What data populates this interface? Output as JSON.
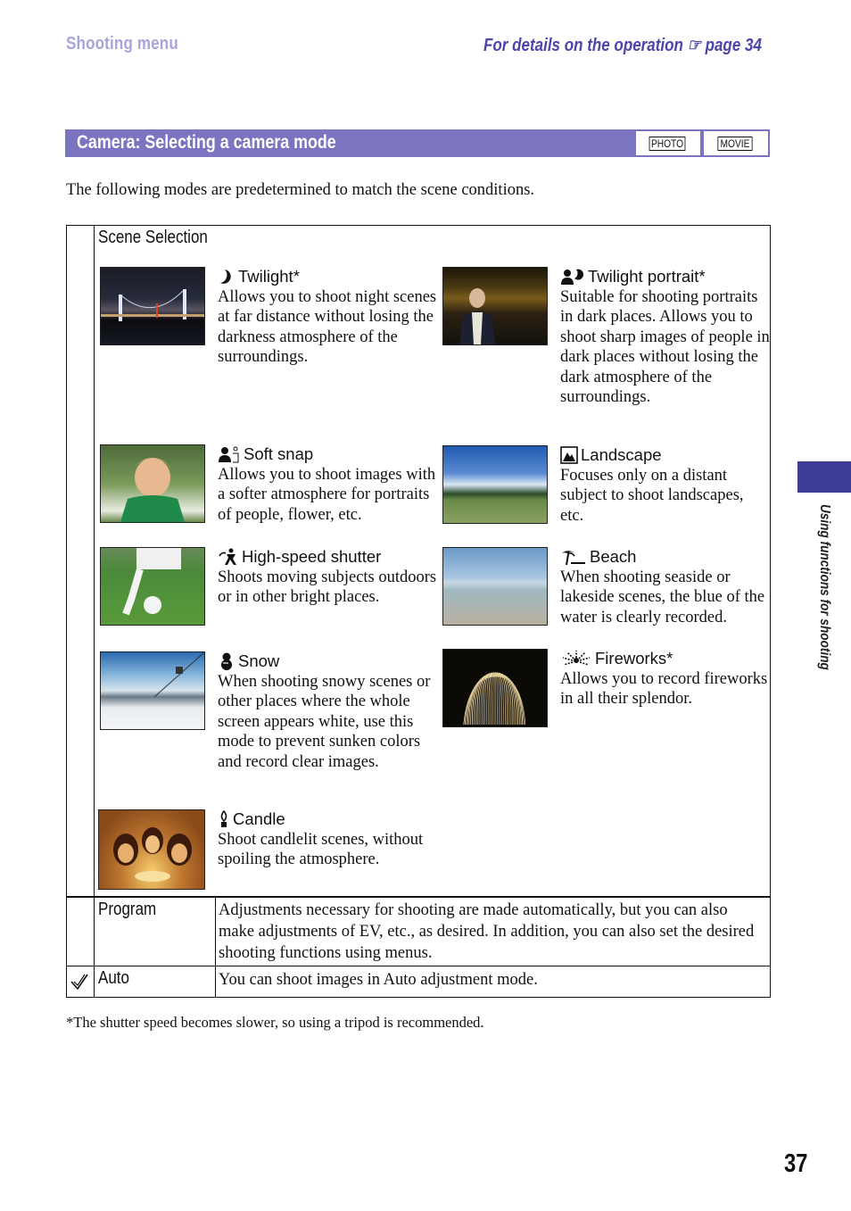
{
  "header": {
    "section": "Shooting menu",
    "operation_ref": "For details on the operation",
    "ref_icon": "pointing-hand-icon",
    "ref_page": "page 34"
  },
  "section": {
    "title": "Camera: Selecting a camera mode",
    "badges": [
      "PHOTO",
      "MOVIE"
    ],
    "color": "#7b74c0"
  },
  "intro": "The following modes are predetermined to match the scene conditions.",
  "table": {
    "scene_selection": {
      "label": "Scene Selection",
      "items": [
        {
          "icon": "moon-icon",
          "title": "Twilight*",
          "desc": "Allows you to shoot night scenes at far distance without losing the darkness atmosphere of the surroundings.",
          "image": "night bridge"
        },
        {
          "icon": "portrait-moon-icon",
          "title": "Twilight portrait*",
          "desc": "Suitable for shooting portraits in dark places. Allows you to shoot sharp images of people in dark places without losing the dark atmosphere of the surroundings.",
          "image": "woman at night"
        },
        {
          "icon": "soft-snap-icon",
          "title": "Soft snap",
          "desc": "Allows you to shoot images with a softer atmosphere for portraits of people, flower, etc.",
          "image": "boy in flowers"
        },
        {
          "icon": "landscape-icon",
          "title": "Landscape",
          "desc": "Focuses only on a distant subject to shoot landscapes, etc.",
          "image": "field and sky"
        },
        {
          "icon": "high-speed-shutter-icon",
          "title": "High-speed shutter",
          "desc": "Shoots moving subjects outdoors or in other bright places.",
          "image": "soccer player"
        },
        {
          "icon": "beach-icon",
          "title": "Beach",
          "desc": "When shooting seaside or lakeside scenes, the blue of the water is clearly recorded.",
          "image": "shallow sea"
        },
        {
          "icon": "snow-icon",
          "title": "Snow",
          "desc": "When shooting snowy scenes or other places where the whole screen appears white, use this mode to prevent sunken colors and record clear images.",
          "image": "ski slope"
        },
        {
          "icon": "fireworks-icon",
          "title": "Fireworks*",
          "desc": "Allows you to record fireworks in all their splendor.",
          "image": "fireworks burst"
        },
        {
          "icon": "candle-icon",
          "title": "Candle",
          "desc": "Shoot candlelit scenes, without spoiling the atmosphere.",
          "image": "birthday candles"
        }
      ]
    },
    "rows": [
      {
        "label": "Program",
        "desc": "Adjustments necessary for shooting are made automatically, but you can also make adjustments of EV, etc., as desired. In addition, you can also set the desired shooting functions using menus.",
        "default": false
      },
      {
        "label": "Auto",
        "desc": "You can shoot images in Auto adjustment mode.",
        "default": true,
        "default_icon": "checkmark-icon"
      }
    ]
  },
  "footnote": "*The shutter speed becomes slower, so using a tripod is recommended.",
  "side_tab": {
    "label": "Using functions for shooting",
    "color": "#3d3a98"
  },
  "page_number": "37"
}
